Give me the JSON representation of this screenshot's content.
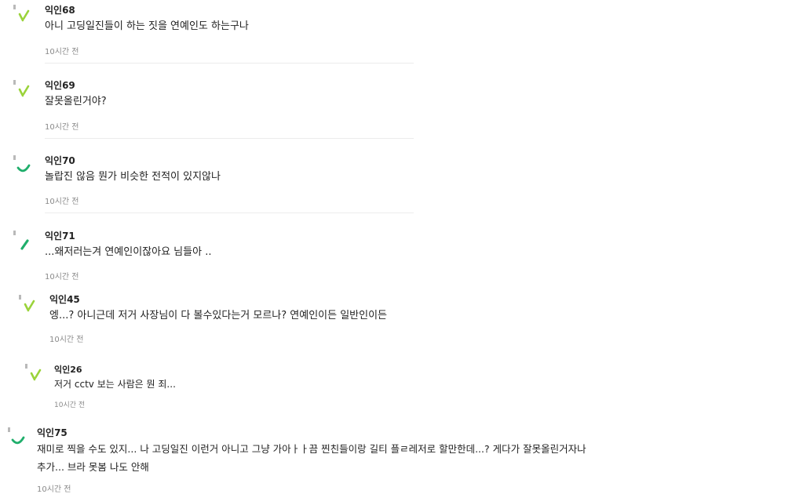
{
  "comments": [
    {
      "author": "익인68",
      "text": "아니 고딩일진들이 하는 짓을 연예인도 하는구나",
      "time": "10시간 전",
      "avatar_icon": "sprout-icon",
      "avatar_color": "#9ad33a"
    },
    {
      "author": "익인69",
      "text": "잘못올린거야?",
      "time": "10시간 전",
      "avatar_icon": "sprout-icon",
      "avatar_color": "#9ad33a"
    },
    {
      "author": "익인70",
      "text": "놀랍진 않음 뭔가 비슷한 전적이 있지않나",
      "time": "10시간 전",
      "avatar_icon": "smile-icon",
      "avatar_color": "#1fae6b"
    },
    {
      "author": "익인71",
      "text": "...왜저러는겨 연예인이잖아요 님들아 ..",
      "time": "10시간 전",
      "avatar_icon": "leaf-icon",
      "avatar_color": "#1fae6b"
    },
    {
      "author": "익인45",
      "text": "엥...? 아니근데 저거 사장님이 다 볼수있다는거 모르나? 연예인이든 일반인이든",
      "time": "10시간 전",
      "avatar_icon": "sprout-icon",
      "avatar_color": "#9ad33a"
    },
    {
      "author": "익인26",
      "text": "저거 cctv 보는 사람은 뭔 죄...",
      "time": "10시간 전",
      "avatar_icon": "sprout-icon",
      "avatar_color": "#9ad33a"
    },
    {
      "author": "익인75",
      "text_lines": [
        "재미로 찍을 수도 있지... 나 고딩일진 이런거 아니고 그냥 가아ㅏㅏ끔 찐친들이랑 길티 플ㄹ레저로 할만한데...? 게다가 잘못올린거자나",
        "추가... 브라 못봄 나도 안해"
      ],
      "time": "10시간 전",
      "avatar_icon": "smile-icon",
      "avatar_color": "#1fae6b"
    }
  ]
}
